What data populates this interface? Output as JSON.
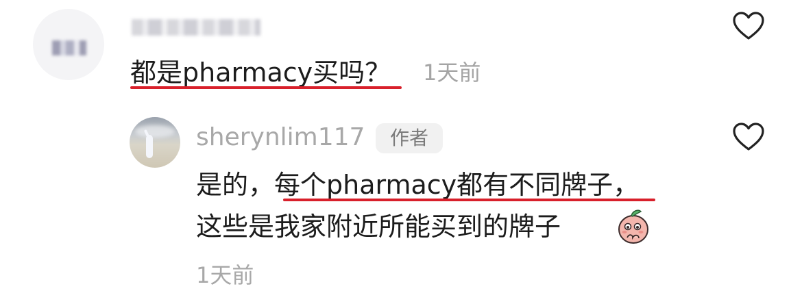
{
  "comment": {
    "username": "",
    "text": "都是pharmacy买吗？",
    "time": "1天前"
  },
  "reply": {
    "username": "sherynlim117",
    "badge": "作者",
    "line1": "是的，每个pharmacy都有不同牌子，",
    "line2": "这些是我家附近所能买到的牌子",
    "time": "1天前",
    "emoji": "peach-shy-emoji"
  },
  "icons": {
    "like": "heart-outline-icon"
  },
  "colors": {
    "underline": "#d8202b",
    "meta_text": "#a8a8a8",
    "badge_bg": "#f1f1f1"
  }
}
